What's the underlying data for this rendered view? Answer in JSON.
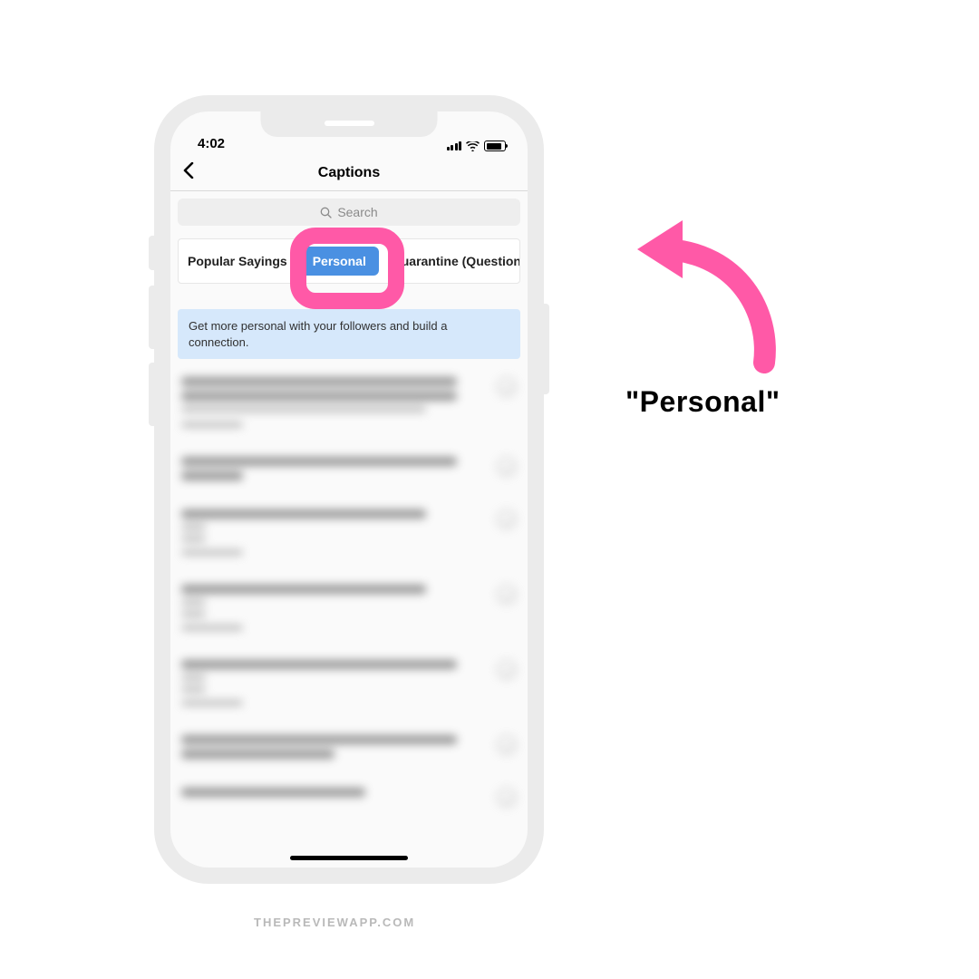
{
  "status": {
    "time": "4:02"
  },
  "nav": {
    "title": "Captions"
  },
  "search": {
    "placeholder": "Search"
  },
  "tabs": {
    "left": "Popular Sayings",
    "active": "Personal",
    "right": "Quarantine (Questions)"
  },
  "banner": "Get more personal with your followers and build a connection.",
  "annotation": "\"Personal\"",
  "watermark": "THEPREVIEWAPP.COM",
  "colors": {
    "highlight": "#ff59a7",
    "active_tab": "#4a90e2",
    "banner_bg": "#d6e8fb"
  }
}
